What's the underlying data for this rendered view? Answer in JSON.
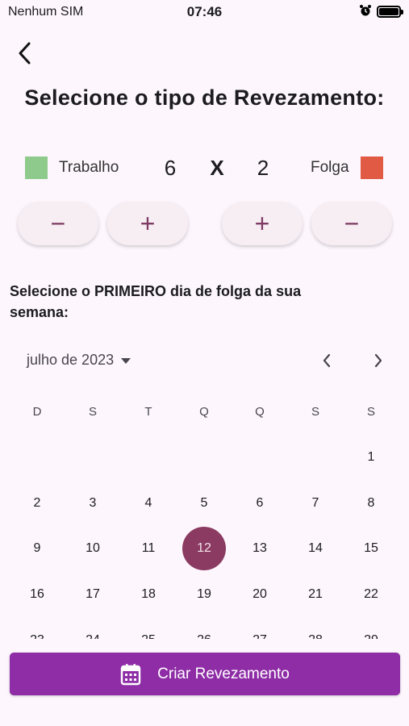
{
  "status_bar": {
    "carrier": "Nenhum SIM",
    "time": "07:46"
  },
  "page": {
    "title": "Selecione o tipo de Revezamento:"
  },
  "shift": {
    "work_label": "Trabalho",
    "work_color": "#8fca8d",
    "work_days": "6",
    "separator": "X",
    "off_days": "2",
    "off_label": "Folga",
    "off_color": "#e05a44"
  },
  "stepper": {
    "minus": "−",
    "plus": "+"
  },
  "instructions": "Selecione o PRIMEIRO dia de folga da sua semana:",
  "calendar": {
    "month_label": "julho de 2023",
    "weekdays": [
      "D",
      "S",
      "T",
      "Q",
      "Q",
      "S",
      "S"
    ],
    "first_weekday_index": 6,
    "visible_days": 29,
    "selected_day": 12
  },
  "cta": {
    "label": "Criar Revezamento",
    "icon": "calendar-icon"
  }
}
